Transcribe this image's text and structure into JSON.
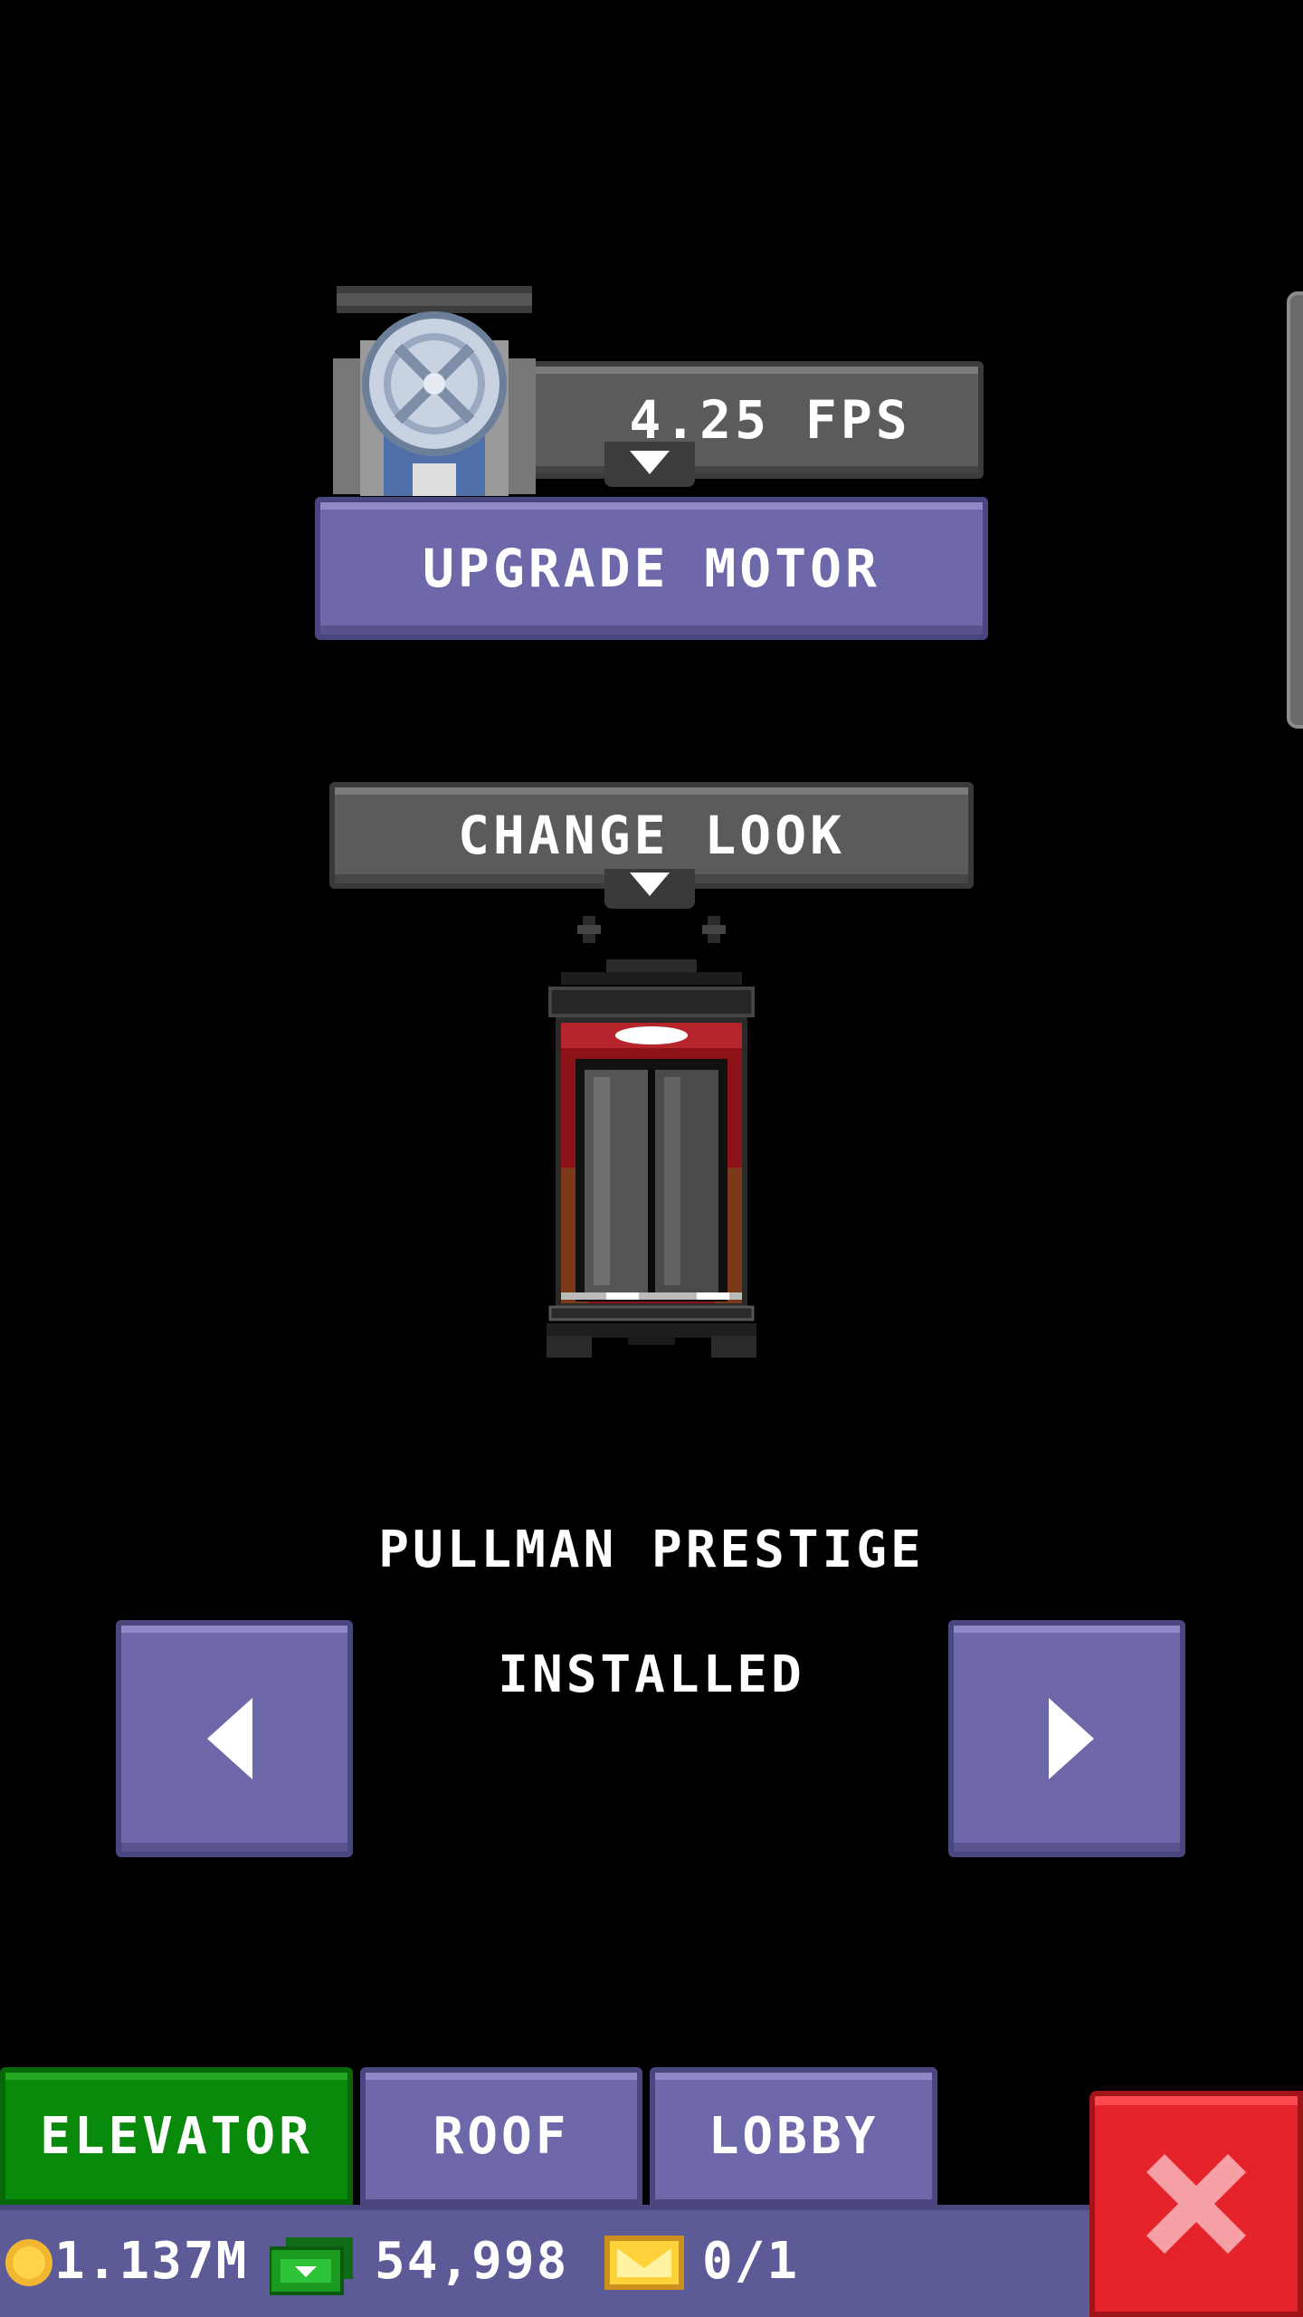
{
  "motor": {
    "speed": "4.25 FPS",
    "upgrade_label": "UPGRADE MOTOR"
  },
  "look": {
    "change_label": "CHANGE LOOK",
    "elevator_name": "PULLMAN PRESTIGE",
    "status": "INSTALLED"
  },
  "tabs": [
    {
      "label": "ELEVATOR",
      "active": true
    },
    {
      "label": "ROOF",
      "active": false
    },
    {
      "label": "LOBBY",
      "active": false
    }
  ],
  "status_bar": {
    "coins": "1.137M",
    "bux": "54,998",
    "tickets": "0/1"
  },
  "colors": {
    "purple_button": "#6c68a9",
    "gray_button": "#5b5b5b",
    "active_tab": "#0a8a0a",
    "close_button": "#e4232a",
    "background": "#000000"
  },
  "icons": {
    "motor": "motor-icon",
    "elevator": "elevator-preview",
    "prev": "arrow-left-icon",
    "next": "arrow-right-icon",
    "coin": "coin-icon",
    "bux": "bux-icon",
    "ticket": "ticket-icon",
    "close": "close-icon"
  }
}
